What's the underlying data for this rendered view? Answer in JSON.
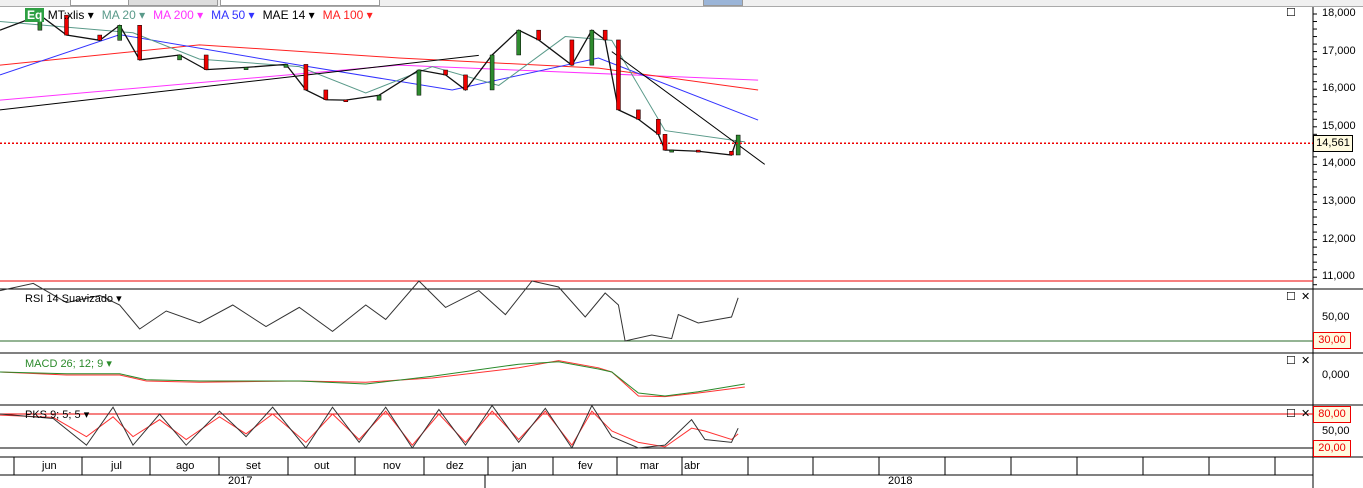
{
  "legend": {
    "symbol_badge": "Eq",
    "symbol": "MT:xlis",
    "ma20": "MA 20",
    "ma200": "MA 200",
    "ma50": "MA 50",
    "mae14": "MAE 14",
    "ma100": "MA 100"
  },
  "colors": {
    "ma20": "#5a9a8a",
    "ma200": "#ff33ff",
    "ma50": "#3333ff",
    "mae14": "#000000",
    "ma100": "#ff2222",
    "macd": "#2a8a2a",
    "signal": "#ff3333"
  },
  "price_axis": {
    "ticks": [
      "18,000",
      "17,000",
      "16,000",
      "15,000",
      "14,000",
      "13,000",
      "12,000",
      "11,000"
    ],
    "tick_values": [
      18000,
      17000,
      16000,
      15000,
      14000,
      13000,
      12000,
      11000
    ],
    "last_price_label": "14,561",
    "last_price": 14561
  },
  "panels": {
    "rsi": {
      "label": "RSI 14 Suavizado",
      "tick": "50,00",
      "low_tag": "30,00"
    },
    "macd": {
      "label": "MACD 26; 12; 9",
      "tick": "0,000"
    },
    "pks": {
      "label": "PKS 9; 5; 5",
      "high_tag": "80,00",
      "tick": "50,00",
      "low_tag": "20,00"
    }
  },
  "time_axis": {
    "months": [
      "jun",
      "jul",
      "ago",
      "set",
      "out",
      "nov",
      "dez",
      "jan",
      "fev",
      "mar",
      "abr"
    ],
    "years": [
      "2017",
      "2018"
    ]
  },
  "chart_data": {
    "type": "line",
    "price": {
      "bars": [
        0,
        6,
        10,
        15,
        18,
        21,
        27,
        31,
        37,
        43,
        46,
        49,
        52,
        57,
        63,
        67,
        70,
        74,
        78,
        81,
        86,
        89,
        91,
        93,
        96,
        99,
        100,
        101,
        105,
        110,
        111
      ],
      "close": [
        17570,
        17970,
        17440,
        17300,
        17700,
        16780,
        16910,
        16520,
        16580,
        16660,
        15980,
        15720,
        15710,
        15840,
        16510,
        16380,
        15980,
        16910,
        17570,
        17310,
        16640,
        17570,
        17310,
        15450,
        15200,
        14800,
        14380,
        14380,
        14350,
        14250,
        14780
      ]
    },
    "ma200": {
      "bars": [
        0,
        60,
        114
      ],
      "values": [
        15710,
        16640,
        16240
      ]
    },
    "ma100": {
      "bars": [
        0,
        30,
        60,
        90,
        114
      ],
      "values": [
        16640,
        17180,
        16830,
        16560,
        15980
      ]
    },
    "ma50": {
      "bars": [
        0,
        18,
        45,
        68,
        90,
        114
      ],
      "values": [
        16380,
        17450,
        16640,
        15980,
        16830,
        15180
      ]
    },
    "ma20": {
      "bars": [
        0,
        20,
        30,
        45,
        55,
        65,
        75,
        85,
        92,
        100,
        112
      ],
      "values": [
        17800,
        17500,
        16800,
        16600,
        15900,
        16600,
        16100,
        17400,
        17300,
        14900,
        14600
      ]
    },
    "trendlines": [
      {
        "bars": [
          0,
          72
        ],
        "values": [
          15450,
          16900
        ]
      },
      {
        "bars": [
          92,
          115
        ],
        "values": [
          17000,
          14000
        ]
      }
    ],
    "rsi": {
      "bars": [
        0,
        5,
        10,
        15,
        18,
        21,
        25,
        30,
        35,
        40,
        45,
        50,
        55,
        58,
        63,
        67,
        72,
        76,
        80,
        84,
        88,
        91,
        93,
        94,
        98,
        101,
        102,
        105,
        108,
        110,
        111
      ],
      "values": [
        72,
        78,
        62,
        68,
        60,
        40,
        55,
        45,
        60,
        42,
        58,
        38,
        60,
        48,
        80,
        58,
        72,
        52,
        80,
        75,
        50,
        70,
        60,
        30,
        35,
        32,
        52,
        45,
        48,
        50,
        66
      ]
    },
    "rsi_levels": [
      30,
      80
    ],
    "macd": {
      "bars": [
        0,
        10,
        18,
        22,
        30,
        45,
        55,
        65,
        78,
        84,
        90,
        92,
        96,
        100,
        105,
        112
      ],
      "macd": [
        0.05,
        0.02,
        0.02,
        -0.08,
        -0.1,
        -0.1,
        -0.15,
        -0.02,
        0.18,
        0.22,
        0.1,
        0.05,
        -0.3,
        -0.35,
        -0.28,
        -0.15
      ],
      "signal": [
        0.05,
        0.0,
        0.0,
        -0.1,
        -0.12,
        -0.1,
        -0.12,
        -0.05,
        0.12,
        0.24,
        0.12,
        0.05,
        -0.35,
        -0.36,
        -0.3,
        -0.2
      ]
    },
    "pks": {
      "bars": [
        0,
        8,
        13,
        17,
        20,
        24,
        28,
        33,
        37,
        41,
        46,
        50,
        54,
        58,
        62,
        66,
        70,
        74,
        78,
        82,
        86,
        89,
        92,
        96,
        100,
        104,
        106,
        110,
        111
      ],
      "k": [
        80,
        72,
        25,
        92,
        25,
        80,
        25,
        85,
        40,
        92,
        20,
        92,
        30,
        92,
        20,
        88,
        25,
        95,
        30,
        90,
        20,
        95,
        40,
        20,
        25,
        70,
        35,
        30,
        55
      ],
      "d": [
        78,
        74,
        40,
        75,
        40,
        70,
        35,
        75,
        45,
        80,
        30,
        80,
        35,
        85,
        25,
        80,
        30,
        85,
        35,
        85,
        25,
        85,
        50,
        30,
        22,
        55,
        50,
        35,
        45
      ]
    },
    "pks_levels": [
      20,
      80
    ]
  }
}
